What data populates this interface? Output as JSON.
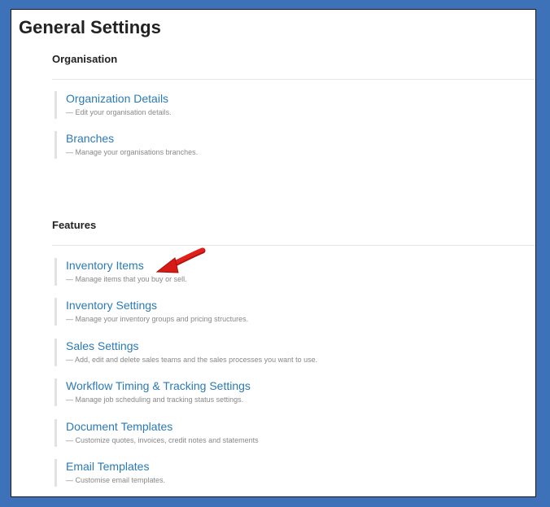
{
  "page": {
    "title": "General Settings"
  },
  "sections": [
    {
      "title": "Organisation",
      "items": [
        {
          "label": "Organization Details",
          "desc": "— Edit your organisation details."
        },
        {
          "label": "Branches",
          "desc": "— Manage your organisations branches."
        }
      ]
    },
    {
      "title": "Features",
      "items": [
        {
          "label": "Inventory Items",
          "desc": "— Manage items that you buy or sell."
        },
        {
          "label": "Inventory Settings",
          "desc": "— Manage your inventory groups and pricing structures."
        },
        {
          "label": "Sales Settings",
          "desc": "— Add, edit and delete sales teams and the sales processes you want to use."
        },
        {
          "label": "Workflow Timing & Tracking Settings",
          "desc": "— Manage job scheduling and tracking status settings."
        },
        {
          "label": "Document Templates",
          "desc": "— Customize quotes, invoices, credit notes and statements"
        },
        {
          "label": "Email Templates",
          "desc": "— Customise email templates."
        }
      ]
    }
  ],
  "colors": {
    "frame": "#3e72b8",
    "link": "#2a7ab6",
    "arrow": "#e0201b"
  },
  "annotation": {
    "icon": "red-arrow-icon"
  }
}
